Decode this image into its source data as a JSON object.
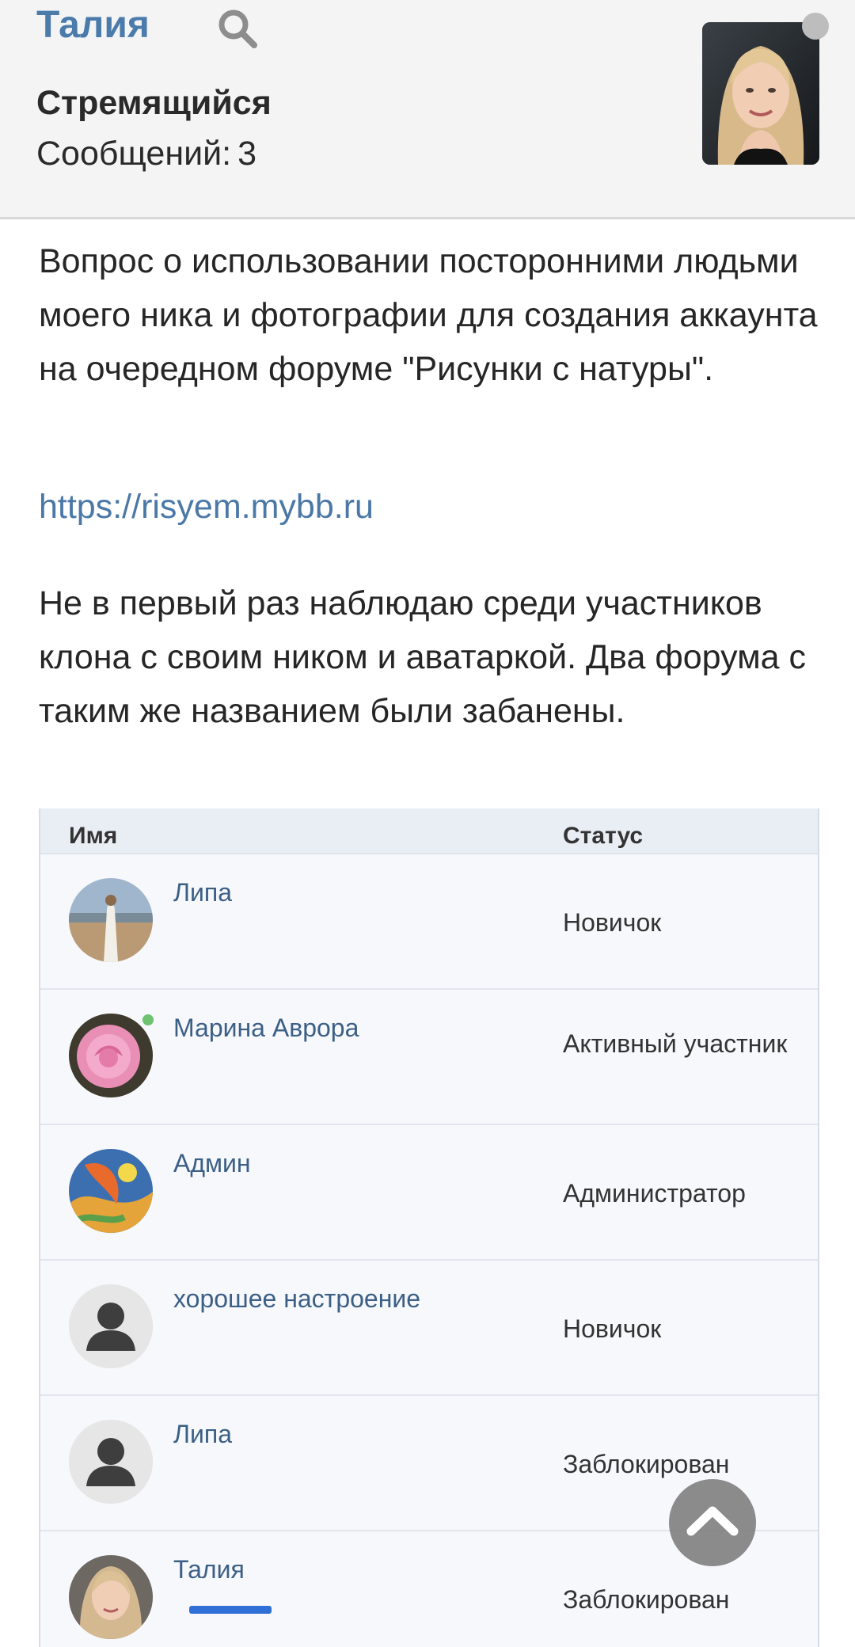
{
  "header": {
    "author_name": "Талия",
    "rank": "Стремящийся",
    "posts_label": "Сообщений:",
    "posts_count": "3",
    "status_color": "#bdbdbd"
  },
  "post": {
    "paragraph1": "Вопрос о использовании посторонними людьми моего ника и фотографии для создания аккаунта на очередном форуме \"Рисунки с натуры\".",
    "link_text": "https://risyem.mybb.ru",
    "paragraph2": "Не в первый раз наблюдаю среди участников клона с своим ником и аватаркой. Два форума с таким же названием были забанены."
  },
  "members_table": {
    "columns": {
      "name": "Имя",
      "status": "Статус"
    },
    "rows": [
      {
        "name": "Липа",
        "status": "Новичок",
        "avatar": "photo-woman-dress"
      },
      {
        "name": "Марина Аврора",
        "status": "Активный участник",
        "avatar": "photo-rose",
        "online": true
      },
      {
        "name": "Админ",
        "status": "Администратор",
        "avatar": "painting-colorful"
      },
      {
        "name": "хорошее настроение",
        "status": "Новичок",
        "avatar": "default-silhouette"
      },
      {
        "name": "Липа",
        "status": "Заблокирован",
        "avatar": "default-silhouette"
      },
      {
        "name": "Талия",
        "status": "Заблокирован",
        "avatar": "photo-blonde-woman"
      }
    ]
  },
  "icons": {
    "search": "search-icon",
    "scroll_top": "chevron-up-icon"
  }
}
